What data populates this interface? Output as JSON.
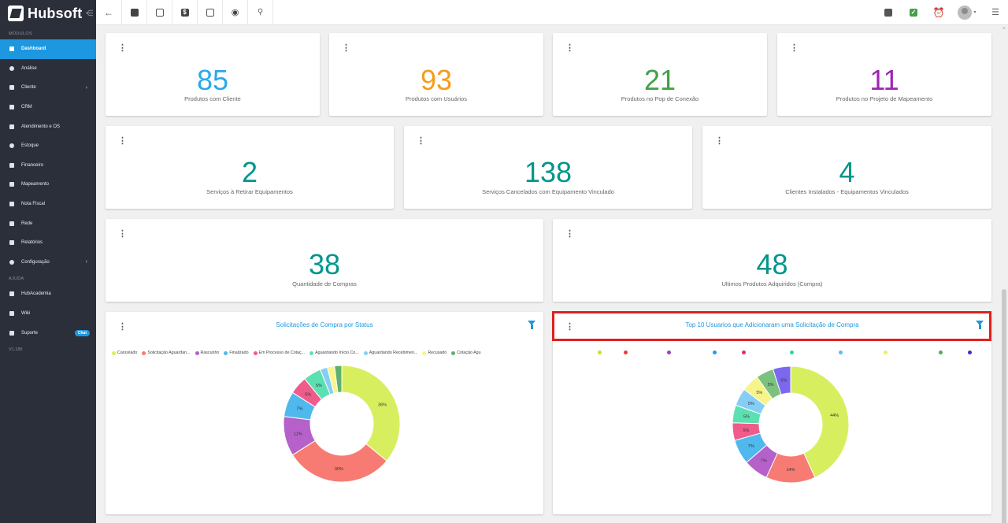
{
  "app": {
    "logo_text": "Hubsoft",
    "version": "V1.189"
  },
  "sidebar": {
    "section_modules": "MÓDULOS",
    "section_help": "AJUDA",
    "items": [
      {
        "label": "Dashboard",
        "icon": "dashboard-icon"
      },
      {
        "label": "Análise",
        "icon": "analysis-icon"
      },
      {
        "label": "Cliente",
        "icon": "client-icon"
      },
      {
        "label": "CRM",
        "icon": "crm-icon"
      },
      {
        "label": "Atendimento e OS",
        "icon": "service-icon"
      },
      {
        "label": "Estoque",
        "icon": "stock-icon"
      },
      {
        "label": "Financeiro",
        "icon": "finance-icon"
      },
      {
        "label": "Mapeamento",
        "icon": "map-icon"
      },
      {
        "label": "Nota Fiscal",
        "icon": "invoice-icon"
      },
      {
        "label": "Rede",
        "icon": "network-icon"
      },
      {
        "label": "Relatórios",
        "icon": "reports-icon"
      },
      {
        "label": "Configuração",
        "icon": "settings-icon"
      }
    ],
    "help_items": [
      {
        "label": "HubAcademia",
        "icon": "academy-icon"
      },
      {
        "label": "Wiki",
        "icon": "wiki-icon"
      },
      {
        "label": "Suporte",
        "icon": "support-icon",
        "badge": "Chat"
      }
    ]
  },
  "stats_row1": [
    {
      "value": "85",
      "label": "Produtos com Cliente",
      "color": "#29a9e8"
    },
    {
      "value": "93",
      "label": "Produtos com Usuários",
      "color": "#f59c1a"
    },
    {
      "value": "21",
      "label": "Produtos no Pop de Conexão",
      "color": "#43a047"
    },
    {
      "value": "11",
      "label": "Produtos no Projeto de Mapeamento",
      "color": "#9c27b0"
    }
  ],
  "stats_row2": [
    {
      "value": "2",
      "label": "Serviços à Retirar Equipamentos",
      "color": "#00968a"
    },
    {
      "value": "138",
      "label": "Serviços Cancelados com Equipamento Vinculado",
      "color": "#00968a"
    },
    {
      "value": "4",
      "label": "Clientes Instalados - Equipamentos Vinculados",
      "color": "#00968a"
    }
  ],
  "stats_row3": [
    {
      "value": "38",
      "label": "Quantidade de Compras",
      "color": "#00968a"
    },
    {
      "value": "48",
      "label": "Ultimos Produtos Adquiridos (Compra)",
      "color": "#00968a"
    }
  ],
  "charts": {
    "left_title": "Solicitações de Compra por Status",
    "right_title": "Top 10 Usuarios que Adicionaram uma Solicitação de Compra"
  },
  "chart_data": [
    {
      "type": "pie",
      "title": "Solicitações de Compra por Status",
      "categories": [
        "Cancelado",
        "Solicitação Aguardan...",
        "Rascunho",
        "Finalizado",
        "Em Processo de Cotaç...",
        "Aguardando Início Co...",
        "Aguardando Recebimen...",
        "Recusado",
        "Cotação Agu"
      ],
      "values": [
        36,
        30,
        11,
        7,
        5,
        5,
        2,
        2,
        2
      ],
      "colors": [
        "#d7ef5e",
        "#f77b72",
        "#b561c9",
        "#4fb8ec",
        "#ef5b8a",
        "#5de0b1",
        "#86cdf5",
        "#f7f58a",
        "#5fb06c"
      ],
      "slice_labels": [
        "36%",
        "30%",
        "11%",
        "7%",
        "5%",
        "5%",
        "",
        "",
        ""
      ]
    },
    {
      "type": "pie",
      "title": "Top 10 Usuarios que Adicionaram uma Solicitação de Compra",
      "categories": [
        "",
        "",
        "",
        "",
        "",
        "",
        "",
        "",
        "",
        ""
      ],
      "values": [
        44,
        14,
        7,
        7,
        5,
        5,
        5,
        5,
        5,
        5
      ],
      "colors": [
        "#d7ef5e",
        "#f77b72",
        "#b561c9",
        "#4fb8ec",
        "#ef5b8a",
        "#5de0b1",
        "#86cdf5",
        "#f7f58a",
        "#7cc17f",
        "#7b68ee"
      ],
      "legend_dot_colors": [
        "#c8e02a",
        "#ef3b2f",
        "#a33fbd",
        "#1e9fe6",
        "#e8286d",
        "#2bd7a0",
        "#5cbcf2",
        "#f2ee5a",
        "#4caf50",
        "#3a2fd9"
      ],
      "slice_labels": [
        "44%",
        "14%",
        "7%",
        "7%",
        "5%",
        "5%",
        "5%",
        "5%",
        "5%",
        "5%"
      ]
    }
  ]
}
